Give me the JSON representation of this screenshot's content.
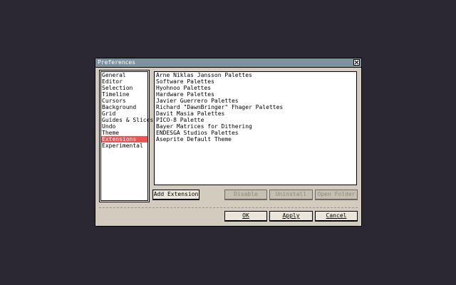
{
  "window": {
    "title": "Preferences"
  },
  "sections": [
    {
      "label": "General",
      "selected": false
    },
    {
      "label": "Editor",
      "selected": false
    },
    {
      "label": "Selection",
      "selected": false
    },
    {
      "label": "Timeline",
      "selected": false
    },
    {
      "label": "Cursors",
      "selected": false
    },
    {
      "label": "Background",
      "selected": false
    },
    {
      "label": "Grid",
      "selected": false
    },
    {
      "label": "Guides & Slices",
      "selected": false
    },
    {
      "label": "Undo",
      "selected": false
    },
    {
      "label": "Theme",
      "selected": false
    },
    {
      "label": "Extensions",
      "selected": true
    },
    {
      "label": "Experimental",
      "selected": false
    }
  ],
  "extensions": [
    "Arne Niklas Jansson Palettes",
    "Software Palettes",
    "Hyohnoo Palettes",
    "Hardware Palettes",
    "Javier Guerrero Palettes",
    "Richard \"DawnBringer\" Fhager Palettes",
    "Davit Masia Palettes",
    "PICO-8 Palette",
    "Bayer Matrices for Dithering",
    "ENDESGA Studios Palettes",
    "Aseprite Default Theme"
  ],
  "buttons": {
    "add_extension": "Add Extension",
    "disable": "Disable",
    "uninstall": "Uninstall",
    "open_folder": "Open Folder",
    "ok": "OK",
    "apply": "Apply",
    "cancel": "Cancel"
  },
  "colors": {
    "selection": "#ec5454",
    "titlebar": "#7d929e",
    "dialog": "#d3cbbe"
  }
}
